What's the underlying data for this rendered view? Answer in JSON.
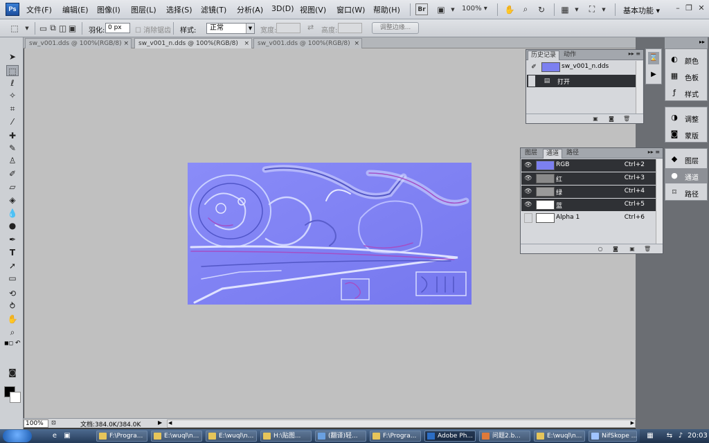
{
  "menubar": {
    "logo": "Ps",
    "items": [
      "文件(F)",
      "编辑(E)",
      "图像(I)",
      "图层(L)",
      "选择(S)",
      "滤镜(T)",
      "分析(A)",
      "3D(D)",
      "视图(V)",
      "窗口(W)",
      "帮助(H)"
    ],
    "br_label": "Br",
    "zoom": "100%",
    "workspace": "基本功能"
  },
  "options": {
    "feather_label": "羽化:",
    "feather_value": "0 px",
    "antialias_label": "消除锯齿",
    "style_label": "样式:",
    "style_value": "正常",
    "width_label": "宽度:",
    "height_label": "高度:",
    "refine_edge": "调整边缘..."
  },
  "doc_tabs": [
    {
      "label": "sw_v001.dds @ 100%(RGB/8)",
      "close": "×"
    },
    {
      "label": "sw_v001_n.dds @ 100%(RGB/8)",
      "close": "×"
    },
    {
      "label": "sw_v001.dds @ 100%(RGB/8)",
      "close": "×"
    }
  ],
  "status": {
    "zoom": "100%",
    "doc_size": "文档:384.0K/384.0K"
  },
  "history_panel": {
    "tabs": [
      "历史记录",
      "动作"
    ],
    "snapshot": "sw_v001_n.dds",
    "steps": [
      "打开"
    ]
  },
  "channels_panel": {
    "tabs": [
      "图层",
      "通道",
      "路径"
    ],
    "channels": [
      {
        "name": "RGB",
        "key": "Ctrl+2",
        "thumb": "#7c80f0"
      },
      {
        "name": "红",
        "key": "Ctrl+3",
        "thumb": "#8a8a8a"
      },
      {
        "name": "绿",
        "key": "Ctrl+4",
        "thumb": "#9a9a9a"
      },
      {
        "name": "蓝",
        "key": "Ctrl+5",
        "thumb": "#ffffff"
      },
      {
        "name": "Alpha 1",
        "key": "Ctrl+6",
        "thumb": "#ffffff"
      }
    ]
  },
  "dock": {
    "group1": [
      "颜色",
      "色板",
      "样式"
    ],
    "group2": [
      "调整",
      "蒙版"
    ],
    "group3": [
      "图层",
      "通道",
      "路径"
    ]
  },
  "taskbar": {
    "tasks": [
      "F:\\Progra...",
      "E:\\wuql\\n...",
      "E:\\wuql\\n...",
      "H:\\贴图...",
      "(翻译)轻...",
      "F:\\Progra...",
      "Adobe Ph...",
      "问题2.b...",
      "E:\\wuql\\n...",
      "NifSkope ..."
    ],
    "active_task": 6,
    "clock": "20:03"
  },
  "colors": {
    "normal_map": "#8082f4",
    "canvas_bg": "#c0c0c0",
    "ui_panel": "#d6d8dc"
  }
}
